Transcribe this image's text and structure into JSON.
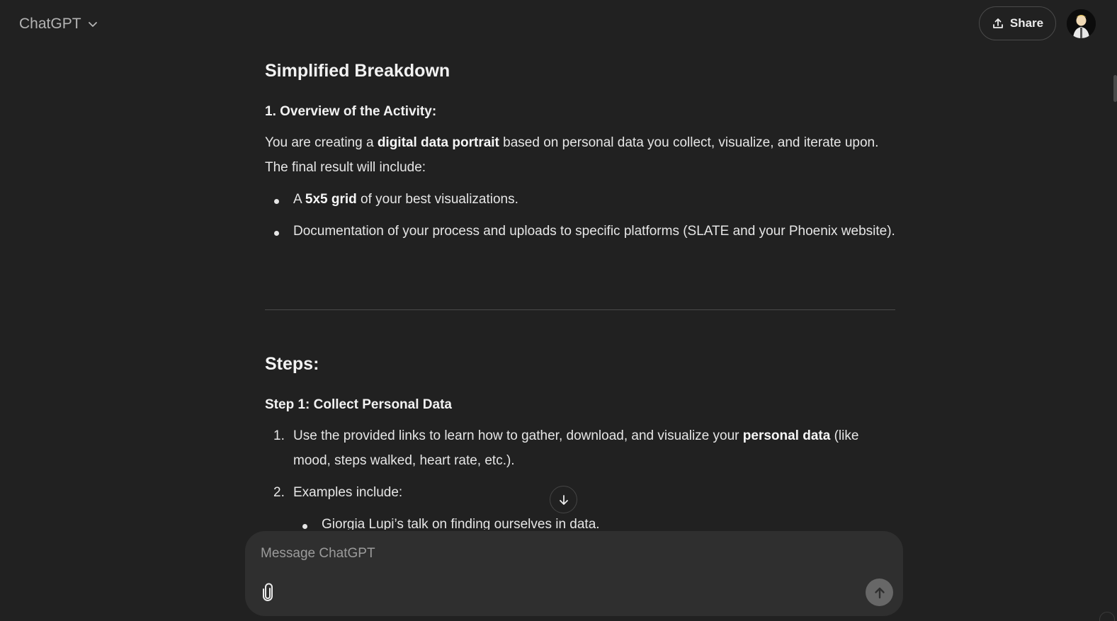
{
  "header": {
    "model_label": "ChatGPT",
    "share_label": "Share"
  },
  "icons": {
    "model_chevron": "chevron-down-icon",
    "share": "share-upload-icon",
    "scroll_down": "arrow-down-icon",
    "attach": "paperclip-icon",
    "send": "arrow-up-icon",
    "avatar": "user-avatar"
  },
  "message": {
    "heading": "Simplified Breakdown",
    "overview_title": "1. Overview of the Activity:",
    "intro": {
      "prefix": "You are creating a ",
      "bold": "digital data portrait",
      "suffix": " based on personal data you collect, visualize, and iterate upon. The final result will include:"
    },
    "bullets": [
      {
        "prefix": "A ",
        "bold": "5x5 grid",
        "suffix": " of your best visualizations."
      },
      {
        "prefix": "Documentation of your process and uploads to specific platforms (SLATE and your Phoenix website).",
        "bold": "",
        "suffix": ""
      }
    ],
    "steps_heading": "Steps:",
    "step1_title": "Step 1: Collect Personal Data",
    "step1_items": [
      {
        "num": "1.",
        "prefix": "Use the provided links to learn how to gather, download, and visualize your ",
        "bold": "personal data",
        "suffix": " (like mood, steps walked, heart rate, etc.)."
      },
      {
        "num": "2.",
        "prefix": "Examples include:",
        "bold": "",
        "suffix": ""
      }
    ],
    "sub_bullets": [
      "Giorgia Lupi’s talk on finding ourselves in data."
    ]
  },
  "composer": {
    "placeholder": "Message ChatGPT"
  },
  "colors": {
    "background": "#212121",
    "composer": "#2f2f2f",
    "text": "#ececec",
    "send_button": "#676767"
  }
}
